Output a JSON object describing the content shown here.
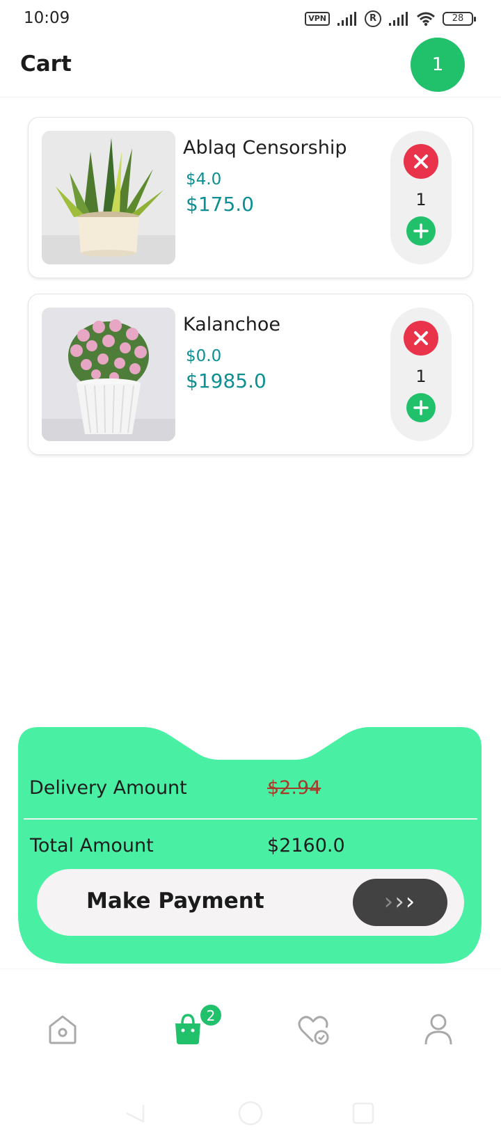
{
  "status_bar": {
    "time": "10:09",
    "vpn": "VPN",
    "registered": "R",
    "battery": "28"
  },
  "header": {
    "title": "Cart",
    "badge_count": "1"
  },
  "cart_items": [
    {
      "name": "Ablaq Censorship",
      "unit_price": "$4.0",
      "total_price": "$175.0",
      "quantity": "1",
      "remove_icon": "close-icon",
      "add_icon": "plus-icon",
      "image": "snake-plant-in-white-pot"
    },
    {
      "name": "Kalanchoe",
      "unit_price": "$0.0",
      "total_price": "$1985.0",
      "quantity": "1",
      "remove_icon": "close-icon",
      "add_icon": "plus-icon",
      "image": "pink-kalanchoe-in-white-pot"
    }
  ],
  "summary": {
    "delivery_label": "Delivery Amount",
    "delivery_value": "$2.94",
    "total_label": "Total Amount",
    "total_value": "$2160.0",
    "pay_label": "Make Payment",
    "pay_icon": "triple-chevron-right-icon"
  },
  "bottom_nav": {
    "items": [
      "home-icon",
      "shopping-bag-icon",
      "favorites-heart-icon",
      "profile-icon"
    ],
    "active": "shopping-bag-icon",
    "bag_badge": "2"
  },
  "colors": {
    "accent_green": "#21c16b",
    "summary_panel": "#49f0a4",
    "price_teal": "#0c8f93",
    "remove_red": "#e9334a",
    "pay_knob": "#424242"
  }
}
